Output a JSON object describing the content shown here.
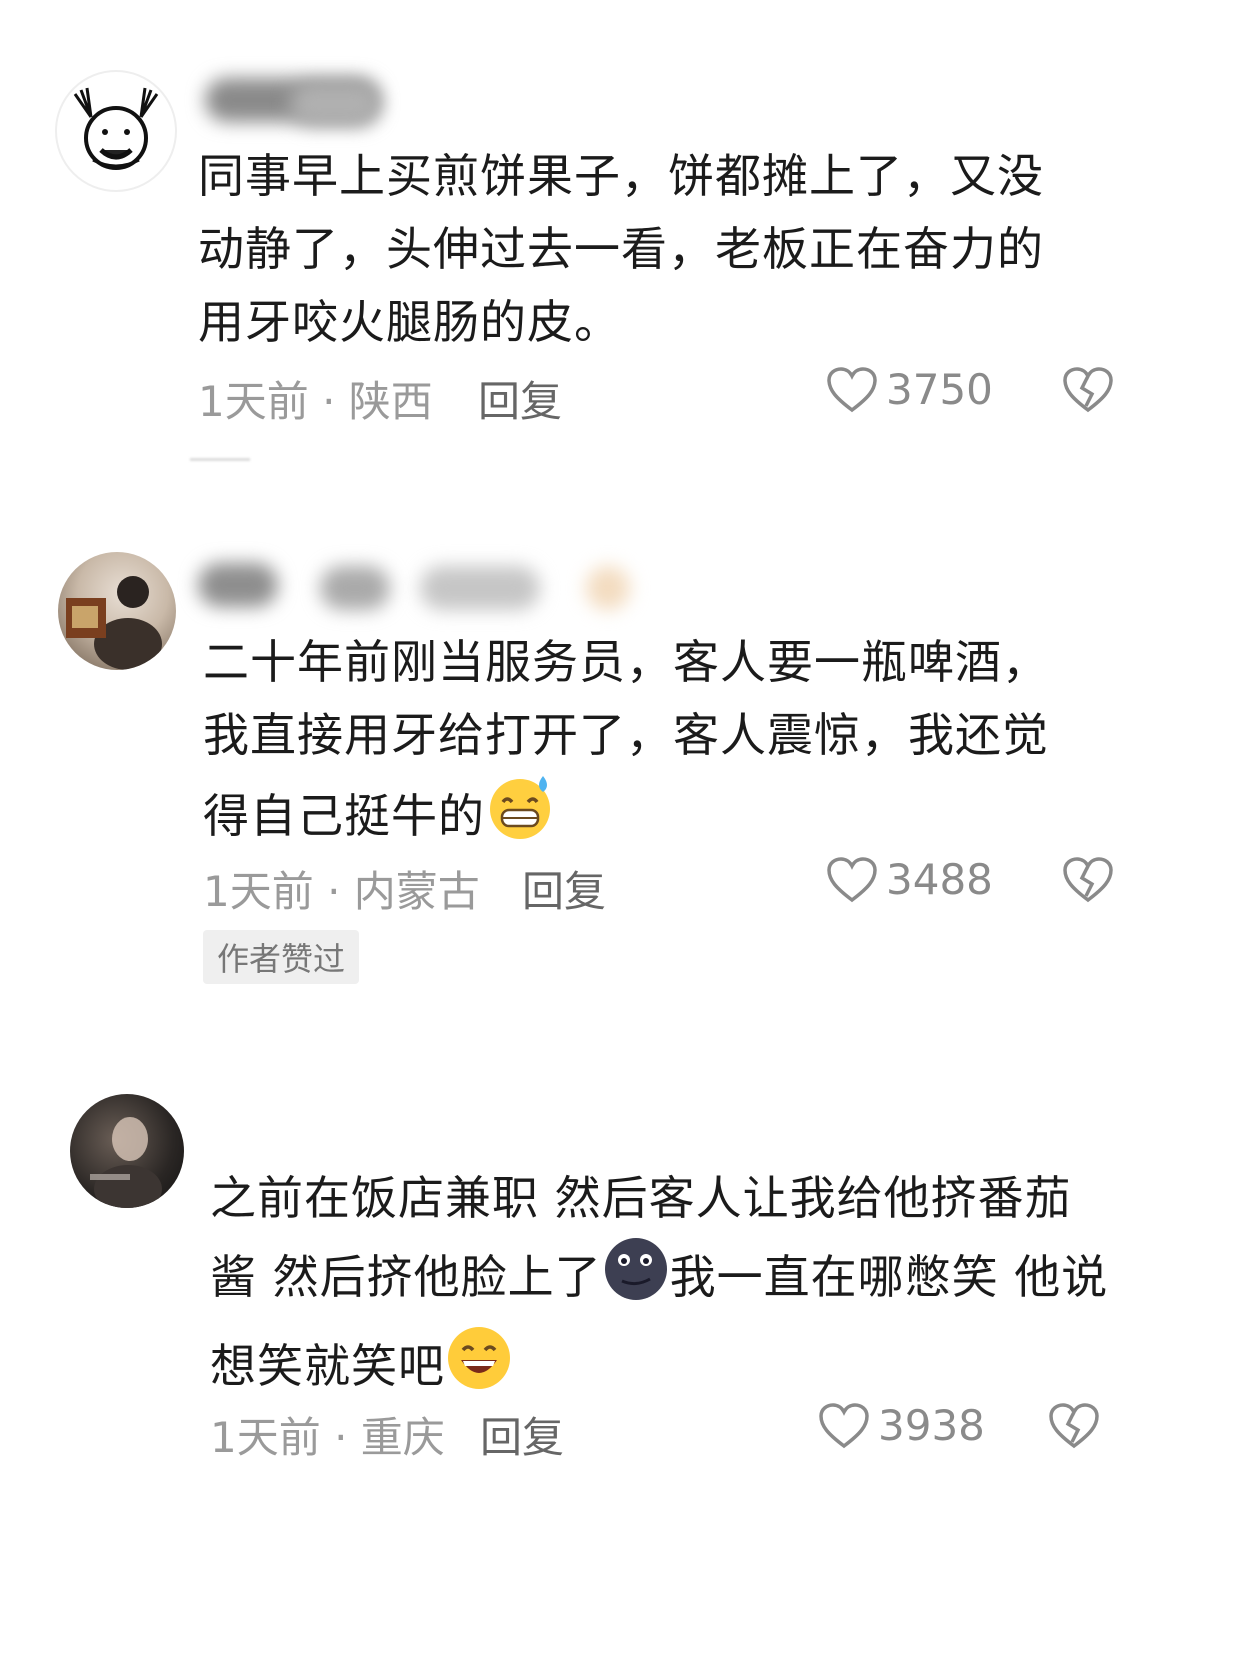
{
  "comments": [
    {
      "text_lines": [
        "同事早上买煎饼果子，饼都摊上了，又没",
        "动静了，头伸过去一看，老板正在奋力的",
        "用牙咬火腿肠的皮。"
      ],
      "meta": "1天前 · 陕西",
      "reply": "回复",
      "likes": "3750"
    },
    {
      "text_lines": [
        "二十年前刚当服务员，客人要一瓶啤酒，",
        "我直接用牙给打开了，客人震惊，我还觉",
        "得自己挺牛的"
      ],
      "meta": "1天前 · 内蒙古",
      "reply": "回复",
      "likes": "3488",
      "badge": "作者赞过"
    },
    {
      "text_lines": [
        "之前在饭店兼职 然后客人让我给他挤番茄",
        "酱 然后挤他脸上了",
        "我一直在哪憋笑 他说",
        "想笑就笑吧"
      ],
      "meta": "1天前 · 重庆",
      "reply": "回复",
      "likes": "3938"
    }
  ],
  "icons": {
    "like": "heart-outline-icon",
    "dislike": "broken-heart-icon",
    "emoji_sweat": "grinning-sweat-emoji",
    "emoji_moon": "new-moon-face-emoji",
    "emoji_smile": "grinning-smile-emoji"
  },
  "colors": {
    "meta": "#9a9a9a",
    "text": "#1b1b1b",
    "badge_bg": "#efefef"
  }
}
